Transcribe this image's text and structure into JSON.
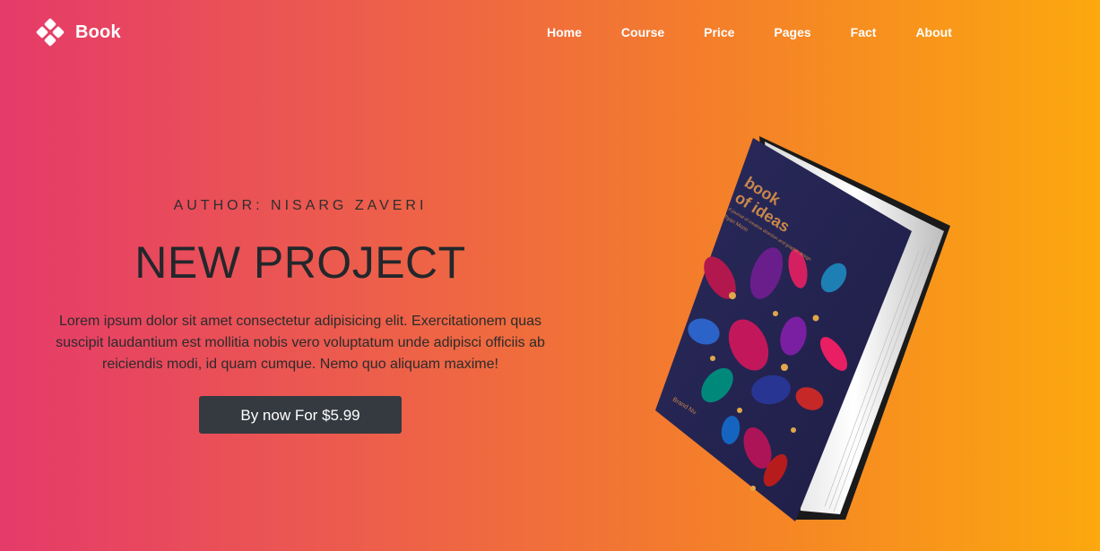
{
  "brand": {
    "name": "Book",
    "logo_icon": "diamond-cluster-icon"
  },
  "nav": {
    "items": [
      {
        "label": "Home"
      },
      {
        "label": "Course"
      },
      {
        "label": "Price"
      },
      {
        "label": "Pages"
      },
      {
        "label": "Fact"
      },
      {
        "label": "About"
      }
    ]
  },
  "hero": {
    "author": "AUTHOR: NISARG ZAVERI",
    "title": "NEW PROJECT",
    "description": "Lorem ipsum dolor sit amet consectetur adipisicing elit. Exercitationem quas suscipit laudantium est mollitia nobis vero voluptatum unde adipisci officiis ab reiciendis modi, id quam cumque. Nemo quo aliquam maxime!",
    "button_label": "By now For $5.99"
  },
  "book": {
    "cover_title_line1": "book",
    "cover_title_line2": "of ideas",
    "cover_subtitle": "A journal of creative direction and graphic design",
    "cover_author": "Ryan Morin",
    "cover_publisher": "Brand Nu"
  },
  "colors": {
    "gradient_start": "#e53a6a",
    "gradient_end": "#fca80e",
    "button_bg": "#353a40",
    "cover_bg": "#272654",
    "cover_title": "#c9874a"
  }
}
